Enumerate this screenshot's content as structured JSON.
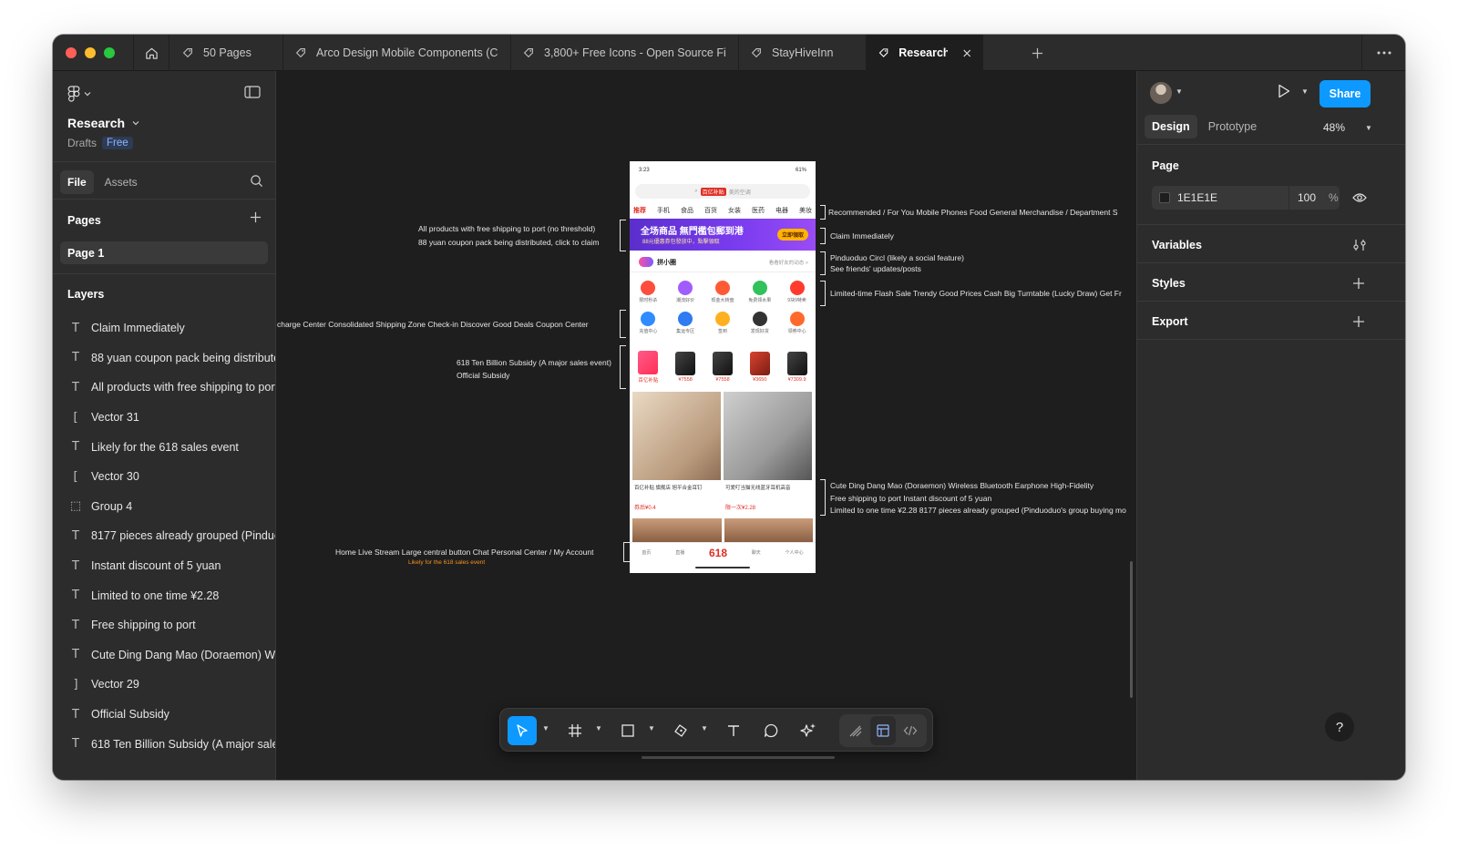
{
  "window": {
    "tabs": [
      {
        "label": "50 Pages"
      },
      {
        "label": "Arco Design Mobile Components (Co"
      },
      {
        "label": "3,800+ Free Icons - Open Source Fig"
      },
      {
        "label": "StayHiveInn"
      },
      {
        "label": "Research"
      }
    ]
  },
  "left_panel": {
    "file_name": "Research",
    "location": "Drafts",
    "plan_badge": "Free",
    "tabs": {
      "file": "File",
      "assets": "Assets"
    },
    "pages_title": "Pages",
    "pages": [
      {
        "label": "Page 1"
      }
    ],
    "layers_title": "Layers",
    "layers": [
      {
        "icon": "text-icon",
        "glyph": "T",
        "label": "Claim Immediately"
      },
      {
        "icon": "text-icon",
        "glyph": "T",
        "label": "88 yuan coupon pack being distributed"
      },
      {
        "icon": "text-icon",
        "glyph": "T",
        "label": "All products with free shipping to port"
      },
      {
        "icon": "vector-icon",
        "glyph": "[",
        "label": "Vector 31"
      },
      {
        "icon": "text-icon",
        "glyph": "T",
        "label": "Likely for the 618 sales event"
      },
      {
        "icon": "vector-icon",
        "glyph": "[",
        "label": "Vector 30"
      },
      {
        "icon": "group-icon",
        "glyph": "⬚",
        "label": "Group 4"
      },
      {
        "icon": "text-icon",
        "glyph": "T",
        "label": "8177 pieces already grouped (Pinduod"
      },
      {
        "icon": "text-icon",
        "glyph": "T",
        "label": "Instant discount of 5 yuan"
      },
      {
        "icon": "text-icon",
        "glyph": "T",
        "label": "Limited to one time ¥2.28"
      },
      {
        "icon": "text-icon",
        "glyph": "T",
        "label": "Free shipping to port"
      },
      {
        "icon": "text-icon",
        "glyph": "T",
        "label": "Cute Ding Dang Mao (Doraemon) Wire"
      },
      {
        "icon": "vector-icon",
        "glyph": "]",
        "label": "Vector 29"
      },
      {
        "icon": "text-icon",
        "glyph": "T",
        "label": "Official Subsidy"
      },
      {
        "icon": "text-icon",
        "glyph": "T",
        "label": "618 Ten Billion Subsidy (A major sales"
      }
    ]
  },
  "canvas": {
    "annotations": {
      "free_shipping": "All products with free shipping to port (no threshold)",
      "coupon_pack": "88 yuan coupon pack being distributed, click to claim",
      "recharge_row": "charge Center  Consolidated Shipping Zone  Check-in  Discover Good Deals  Coupon Center",
      "subsidy": "618 Ten Billion Subsidy (A major sales event)",
      "official_subsidy": "Official Subsidy",
      "bottom_nav": "Home  Live Stream  Large central button  Chat  Personal Center / My Account",
      "likely_618": "Likely for the 618 sales event",
      "categories": "Recommended / For You  Mobile Phones  Food  General Merchandise / Department S",
      "claim": "Claim Immediately",
      "circle": "Pinduoduo Circl (likely a social feature)",
      "friends": "See friends' updates/posts",
      "flash_row": "Limited-time Flash Sale  Trendy Good Prices  Cash Big Turntable (Lucky Draw)  Get Fr",
      "doraemon": "Cute Ding Dang Mao (Doraemon) Wireless Bluetooth Earphone High-Fidelity",
      "shipping_discount": "Free shipping to port  Instant discount of 5 yuan",
      "limited": "Limited to one time ¥2.28  8177 pieces already grouped (Pinduoduo's group buying mo"
    },
    "phone": {
      "time": "3:23",
      "battery": "61%",
      "search_badge": "百亿补贴",
      "search_placeholder": "美的空调",
      "categories": [
        "推荐",
        "手机",
        "食品",
        "百货",
        "女装",
        "医药",
        "电器",
        "美妆"
      ],
      "banner_title": "全场商品 無門檻包郵到港",
      "banner_sub": "88元優惠券包發放中，點擊領取",
      "banner_button": "立即領取",
      "circle_title": "拼小圈",
      "circle_link": "看看好友的动态 >",
      "icons_row1": [
        {
          "label": "限时秒杀",
          "color": "#ff4d3d"
        },
        {
          "label": "潮流好价",
          "color": "#a15cff"
        },
        {
          "label": "现金大转盘",
          "color": "#ff5a36"
        },
        {
          "label": "免费领水果",
          "color": "#31c25b"
        },
        {
          "label": "9块9特卖",
          "color": "#ff3b2f"
        }
      ],
      "icons_row2": [
        {
          "label": "充值中心",
          "color": "#2f8cff"
        },
        {
          "label": "集运专区",
          "color": "#2e7bf2"
        },
        {
          "label": "签到",
          "color": "#ffb020"
        },
        {
          "label": "发现好货",
          "color": "#333333"
        },
        {
          "label": "领券中心",
          "color": "#ff6a2c"
        }
      ],
      "deals": [
        {
          "label": "百亿补贴"
        },
        {
          "label": "¥7558"
        },
        {
          "label": "¥7558"
        },
        {
          "label": "¥3650"
        },
        {
          "label": "¥7309.9"
        }
      ],
      "products": [
        {
          "title": "百亿补贴 旗舰店 旭平合金耳钉",
          "price": "券后¥0.4"
        },
        {
          "title": "可爱叮当猫无线蓝牙耳机高音",
          "price": "限一次¥2.28"
        }
      ],
      "nav": [
        "首页",
        "直播",
        "618",
        "聊天",
        "个人中心"
      ]
    }
  },
  "toolbar": {
    "tools": [
      "move-tool",
      "frame-tool",
      "shape-tool",
      "pen-tool",
      "text-tool",
      "comment-tool",
      "actions-tool",
      "draw-mode",
      "design-mode",
      "dev-mode"
    ]
  },
  "right_panel": {
    "share_label": "Share",
    "tabs": {
      "design": "Design",
      "prototype": "Prototype"
    },
    "zoom": "48%",
    "page_section": "Page",
    "fill_hex": "1E1E1E",
    "fill_opacity": "100",
    "fill_unit": "%",
    "variables": "Variables",
    "styles": "Styles",
    "export": "Export",
    "help": "?"
  },
  "colors": {
    "accent": "#0d99ff",
    "canvas_bg": "#1e1e1e",
    "panel_bg": "#2c2c2c"
  }
}
